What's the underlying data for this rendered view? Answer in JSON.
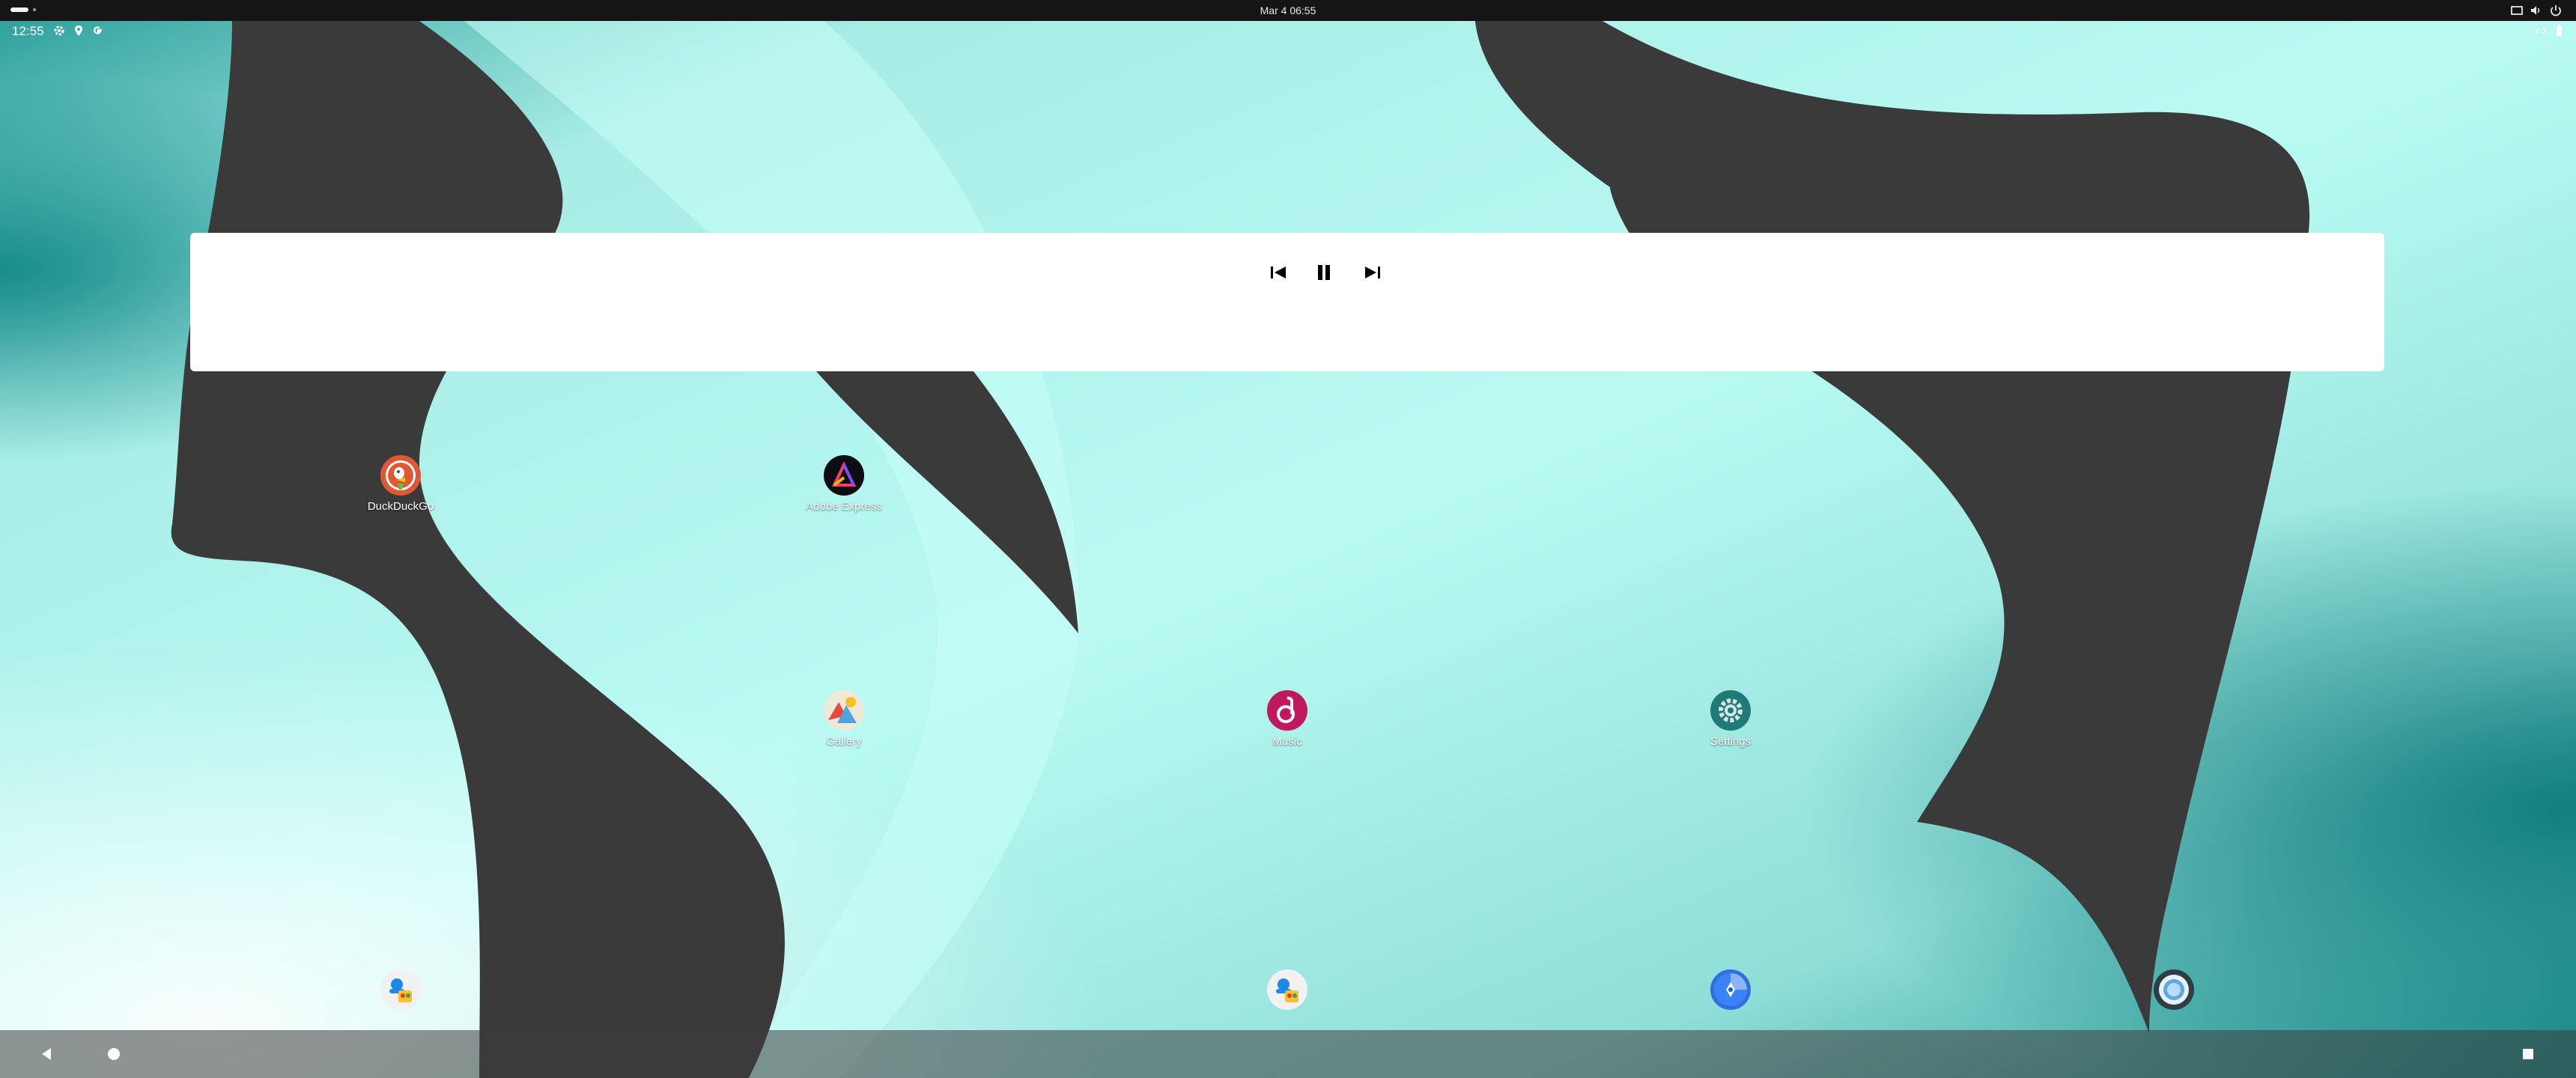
{
  "system_bar": {
    "datetime": "Mar 4  06:55"
  },
  "status_bar": {
    "time": "12:55",
    "icons": [
      "settings-icon",
      "location-icon",
      "google-icon"
    ],
    "right_icons": [
      "expand-arrows-icon",
      "battery-icon"
    ]
  },
  "media_widget": {
    "controls": [
      "previous-icon",
      "pause-icon",
      "next-icon"
    ]
  },
  "apps": {
    "duckduckgo": "DuckDuckGo",
    "adobe_express": "Adobe Express",
    "gallery": "Gallery",
    "music": "Music",
    "settings": "Settings"
  },
  "dock": [
    "contacts-icon",
    "contacts-icon",
    "compass-icon",
    "camera-icon"
  ],
  "colors": {
    "wallpaper_light": "#b8fbf1",
    "wallpaper_teal": "#1d8f8f",
    "wallpaper_dark": "#3a3a3a",
    "music_accent": "#c0185f",
    "settings_accent": "#1f7a78"
  }
}
